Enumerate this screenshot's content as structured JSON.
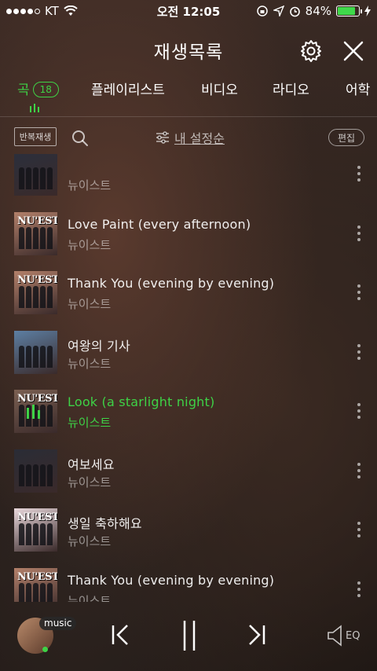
{
  "status_bar": {
    "carrier": "KT",
    "time": "오전 12:05",
    "battery": "84%"
  },
  "header": {
    "title": "재생목록"
  },
  "tabs": [
    {
      "label": "곡",
      "badge": "18"
    },
    {
      "label": "플레이리스트"
    },
    {
      "label": "비디오"
    },
    {
      "label": "라디오"
    },
    {
      "label": "어학"
    }
  ],
  "toolbar": {
    "repeat_label": "반복재생",
    "sort_label": "내 설정순",
    "edit_label": "편집"
  },
  "songs": [
    {
      "title": "",
      "artist": "뉴이스트",
      "thumb_text": "",
      "thumb_color": "#2b2f3c"
    },
    {
      "title": "Love Paint (every afternoon)",
      "artist": "뉴이스트",
      "thumb_text": "NU'EST",
      "thumb_color": "#b3806a"
    },
    {
      "title": "Thank You (evening by evening)",
      "artist": "뉴이스트",
      "thumb_text": "NU'EST",
      "thumb_color": "#b3806a"
    },
    {
      "title": "여왕의 기사",
      "artist": "뉴이스트",
      "thumb_text": "",
      "thumb_color": "#5d7fa3"
    },
    {
      "title": "Look (a starlight night)",
      "artist": "뉴이스트",
      "thumb_text": "NU'EST",
      "thumb_color": "#7b6052",
      "playing": true
    },
    {
      "title": "여보세요",
      "artist": "뉴이스트",
      "thumb_text": "",
      "thumb_color": "#2a2c36"
    },
    {
      "title": "생일 축하해요",
      "artist": "뉴이스트",
      "thumb_text": "NU'EST",
      "thumb_color": "#e9d8dc"
    },
    {
      "title": "Thank You (evening by evening)",
      "artist": "뉴이스트",
      "thumb_text": "NU'EST",
      "thumb_color": "#b3806a"
    }
  ],
  "player": {
    "badge": "music",
    "eq_label": "EQ"
  },
  "colors": {
    "accent": "#3ed246"
  }
}
